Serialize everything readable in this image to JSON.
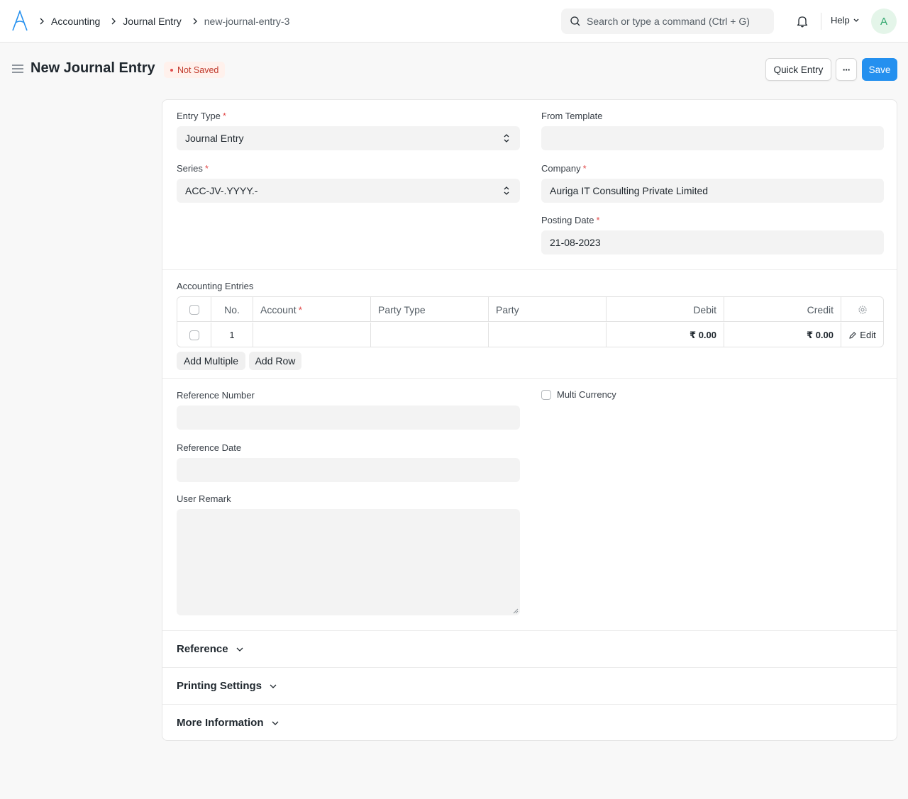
{
  "navbar": {
    "breadcrumbs": [
      "Accounting",
      "Journal Entry",
      "new-journal-entry-3"
    ],
    "search_placeholder": "Search or type a command (Ctrl + G)",
    "help_label": "Help",
    "avatar_initial": "A"
  },
  "page": {
    "title": "New Journal Entry",
    "status": "Not Saved",
    "quick_entry_label": "Quick Entry",
    "more_label": "···",
    "save_label": "Save"
  },
  "form": {
    "entry_type": {
      "label": "Entry Type",
      "value": "Journal Entry"
    },
    "from_template": {
      "label": "From Template",
      "value": ""
    },
    "series": {
      "label": "Series",
      "value": "ACC-JV-.YYYY.-"
    },
    "company": {
      "label": "Company",
      "value": "Auriga IT Consulting Private Limited"
    },
    "posting_date": {
      "label": "Posting Date",
      "value": "21-08-2023"
    },
    "accounting_entries": {
      "label": "Accounting Entries",
      "columns": [
        "No.",
        "Account",
        "Party Type",
        "Party",
        "Debit",
        "Credit"
      ],
      "rows": [
        {
          "no": "1",
          "account": "",
          "party_type": "",
          "party": "",
          "debit": "₹ 0.00",
          "credit": "₹ 0.00",
          "edit": "Edit"
        }
      ],
      "add_multiple_label": "Add Multiple",
      "add_row_label": "Add Row"
    },
    "reference_number": {
      "label": "Reference Number",
      "value": ""
    },
    "multi_currency": {
      "label": "Multi Currency",
      "checked": false
    },
    "reference_date": {
      "label": "Reference Date",
      "value": ""
    },
    "user_remark": {
      "label": "User Remark",
      "value": ""
    },
    "sections": [
      "Reference",
      "Printing Settings",
      "More Information"
    ]
  },
  "colors": {
    "primary": "#2490ef",
    "required": "#e24c4c",
    "status_bg": "#fff1ec",
    "status_text": "#c0392b"
  }
}
